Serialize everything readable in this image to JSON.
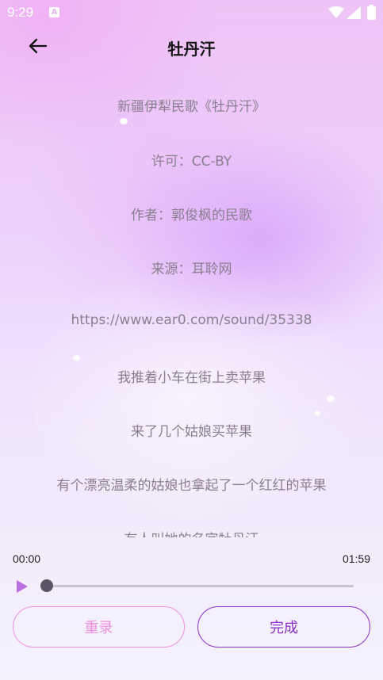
{
  "status_bar": {
    "time": "9:29",
    "notification_letter": "A"
  },
  "header": {
    "title": "牡丹汗"
  },
  "lyrics": [
    "新疆伊犁民歌《牡丹汗》",
    "许可：CC-BY",
    "作者：郭俊枫的民歌",
    "来源：耳聆网",
    "https://www.ear0.com/sound/35338",
    "我推着小车在街上卖苹果",
    "来了几个姑娘买苹果",
    "有个漂亮温柔的姑娘也拿起了一个红红的苹果",
    "有人叫她的名字牡丹汗"
  ],
  "player": {
    "current_time": "00:00",
    "total_time": "01:59",
    "progress_fraction": 0.0
  },
  "buttons": {
    "rerecord_label": "重录",
    "done_label": "完成"
  },
  "colors": {
    "accent_pink": "#ee8fe0",
    "accent_purple": "#8a2fc8",
    "lyric_text": "#8a7f8e"
  },
  "icons": {
    "back": "arrow-left-icon",
    "play": "play-icon",
    "wifi": "wifi-icon",
    "signal": "signal-icon",
    "battery": "battery-icon"
  }
}
